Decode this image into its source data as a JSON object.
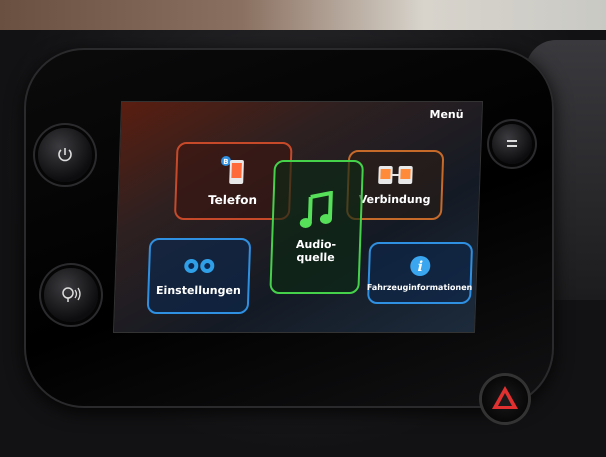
{
  "screen": {
    "menu_label": "Menü",
    "tiles": {
      "telefon": {
        "label": "Telefon",
        "icon": "phone-icon"
      },
      "verbindung": {
        "label": "Verbindung",
        "icon": "connection-icon"
      },
      "einstellungen": {
        "label": "Einstellungen",
        "icon": "gears-icon"
      },
      "audioquelle": {
        "label_line1": "Audio-",
        "label_line2": "quelle",
        "icon": "music-note-icon"
      },
      "fahrzeuginfo": {
        "label": "Fahrzeuginformationen",
        "icon": "info-icon"
      }
    }
  },
  "colors": {
    "telefon": "#c64a2a",
    "verbindung": "#c66a2a",
    "einstellungen": "#2f8fe0",
    "audioquelle": "#45d14a",
    "fahrzeuginfo": "#2f8fe0"
  }
}
